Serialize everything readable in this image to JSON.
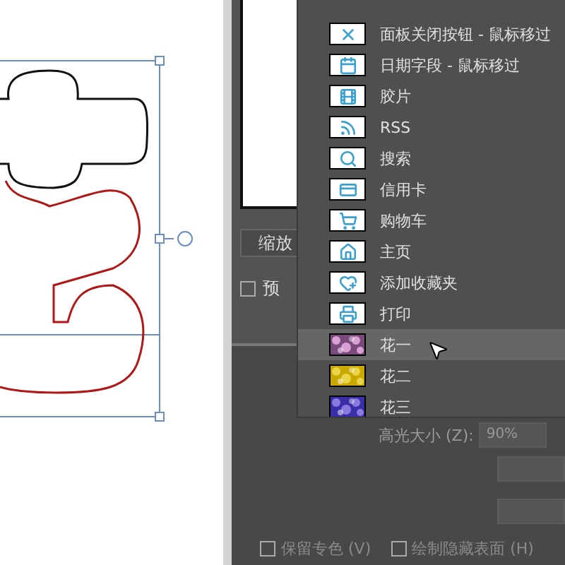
{
  "panel": {
    "zoom_button": "缩放",
    "preview_checkbox": {
      "label": "预",
      "checked": false
    }
  },
  "menu": {
    "items": [
      {
        "label": "面板关闭按钮 - 鼠标移过",
        "kind": "icon",
        "selected": false
      },
      {
        "label": "日期字段 - 鼠标移过",
        "kind": "icon",
        "selected": false
      },
      {
        "label": "胶片",
        "kind": "icon",
        "selected": false
      },
      {
        "label": "RSS",
        "kind": "icon",
        "selected": false
      },
      {
        "label": "搜索",
        "kind": "icon",
        "selected": false
      },
      {
        "label": "信用卡",
        "kind": "icon",
        "selected": false
      },
      {
        "label": "购物车",
        "kind": "icon",
        "selected": false
      },
      {
        "label": "主页",
        "kind": "icon",
        "selected": false
      },
      {
        "label": "添加收藏夹",
        "kind": "icon",
        "selected": false
      },
      {
        "label": "打印",
        "kind": "icon",
        "selected": false
      },
      {
        "label": "花一",
        "kind": "picture",
        "selected": true
      },
      {
        "label": "花二",
        "kind": "picture",
        "selected": false
      },
      {
        "label": "花三",
        "kind": "picture",
        "selected": false
      }
    ]
  },
  "highlight_size": {
    "label": "高光大小 (Z):",
    "value": "90%"
  },
  "options": [
    {
      "label": "保留专色 (V)",
      "checked": false
    },
    {
      "label": "绘制隐藏表面 (H)",
      "checked": false
    }
  ]
}
